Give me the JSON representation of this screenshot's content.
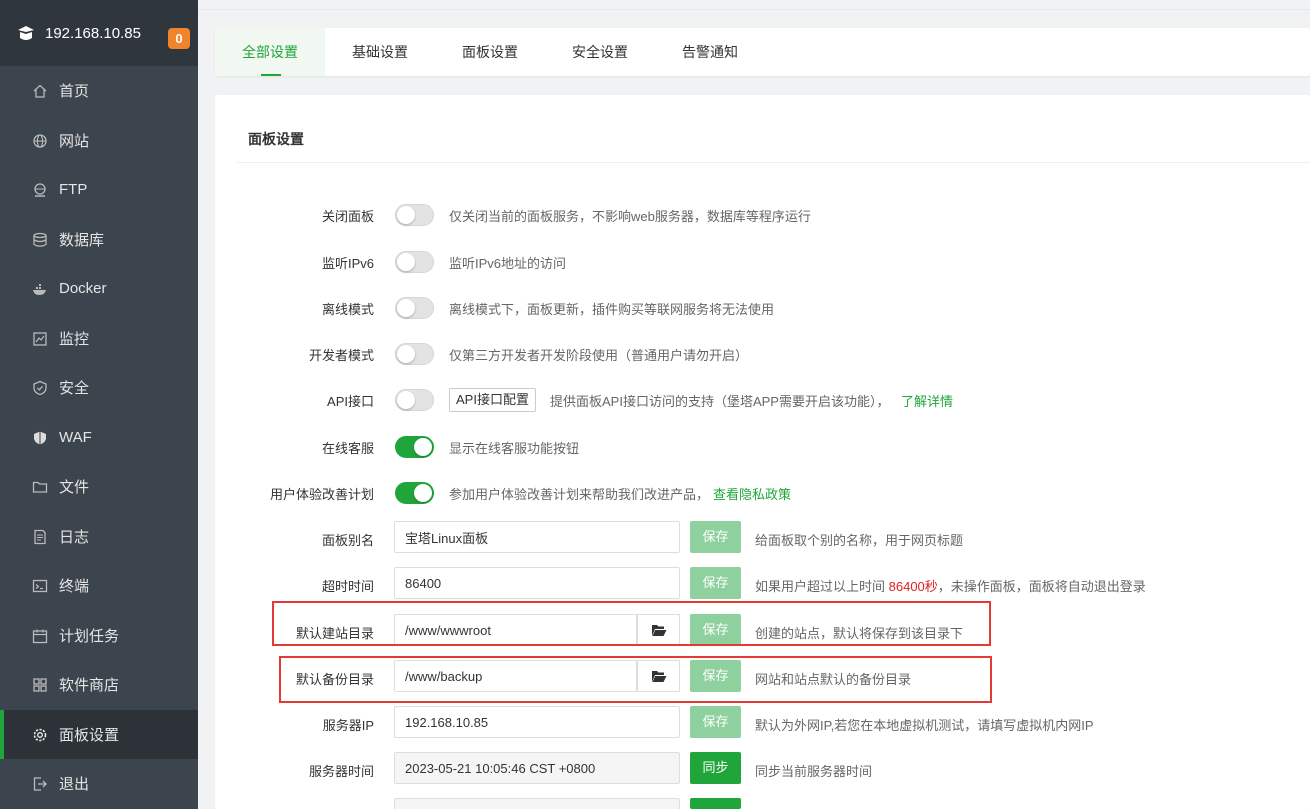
{
  "sidebar": {
    "host": "192.168.10.85",
    "badge": "0",
    "items": [
      {
        "label": "首页",
        "icon": "home-icon"
      },
      {
        "label": "网站",
        "icon": "globe-icon"
      },
      {
        "label": "FTP",
        "icon": "ftp-icon"
      },
      {
        "label": "数据库",
        "icon": "database-icon"
      },
      {
        "label": "Docker",
        "icon": "docker-icon"
      },
      {
        "label": "监控",
        "icon": "monitor-icon"
      },
      {
        "label": "安全",
        "icon": "shield-check-icon"
      },
      {
        "label": "WAF",
        "icon": "waf-shield-icon"
      },
      {
        "label": "文件",
        "icon": "folder-icon"
      },
      {
        "label": "日志",
        "icon": "log-icon"
      },
      {
        "label": "终端",
        "icon": "terminal-icon"
      },
      {
        "label": "计划任务",
        "icon": "calendar-icon"
      },
      {
        "label": "软件商店",
        "icon": "apps-grid-icon"
      },
      {
        "label": "面板设置",
        "icon": "gear-icon"
      },
      {
        "label": "退出",
        "icon": "logout-icon"
      }
    ],
    "active_index": 13
  },
  "tabs": [
    "全部设置",
    "基础设置",
    "面板设置",
    "安全设置",
    "告警通知"
  ],
  "active_tab": 0,
  "panel": {
    "title": "面板设置",
    "toggles": [
      {
        "label": "关闭面板",
        "on": false,
        "desc": "仅关闭当前的面板服务，不影响web服务器，数据库等程序运行"
      },
      {
        "label": "监听IPv6",
        "on": false,
        "desc": "监听IPv6地址的访问"
      },
      {
        "label": "离线模式",
        "on": false,
        "desc": "离线模式下，面板更新，插件购买等联网服务将无法使用"
      },
      {
        "label": "开发者模式",
        "on": false,
        "desc": "仅第三方开发者开发阶段使用（普通用户请勿开启）"
      },
      {
        "label": "API接口",
        "on": false,
        "button": "API接口配置",
        "desc": "提供面板API接口访问的支持（堡塔APP需要开启该功能），",
        "link": "了解详情"
      },
      {
        "label": "在线客服",
        "on": true,
        "desc": "显示在线客服功能按钮"
      },
      {
        "label": "用户体验改善计划",
        "on": true,
        "desc": "参加用户体验改善计划来帮助我们改进产品，",
        "link": "查看隐私政策"
      }
    ],
    "fields": {
      "alias": {
        "label": "面板别名",
        "value": "宝塔Linux面板",
        "button": "保存",
        "desc": "给面板取个别的名称，用于网页标题"
      },
      "timeout": {
        "label": "超时时间",
        "value": "86400",
        "button": "保存",
        "desc_pre": "如果用户超过以上时间 ",
        "desc_hl": "86400秒",
        "desc_post": "，未操作面板，面板将自动退出登录"
      },
      "site_dir": {
        "label": "默认建站目录",
        "value": "/www/wwwroot",
        "button": "保存",
        "desc": "创建的站点，默认将保存到该目录下"
      },
      "backup_dir": {
        "label": "默认备份目录",
        "value": "/www/backup",
        "button": "保存",
        "desc": "网站和站点默认的备份目录"
      },
      "server_ip": {
        "label": "服务器IP",
        "value": "192.168.10.85",
        "button": "保存",
        "desc": "默认为外网IP,若您在本地虚拟机测试，请填写虚拟机内网IP"
      },
      "server_time": {
        "label": "服务器时间",
        "value": "2023-05-21 10:05:46 CST +0800",
        "button": "同步",
        "desc": "同步当前服务器时间"
      }
    }
  },
  "colors": {
    "accent": "#20a53a",
    "sidebar": "#3c444d",
    "highlight_box": "#e53935"
  }
}
